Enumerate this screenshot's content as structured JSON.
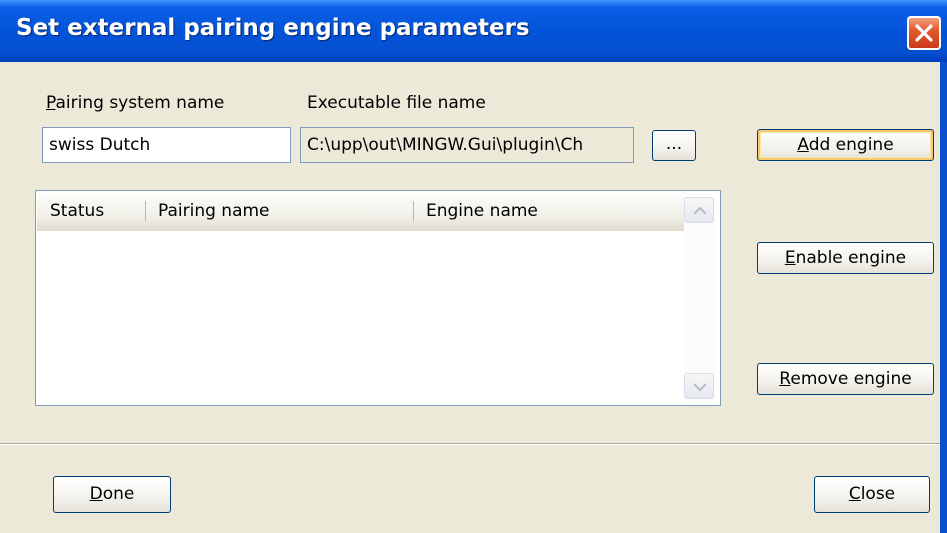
{
  "window": {
    "title": "Set external pairing engine parameters"
  },
  "form": {
    "pairing_system_label_acc": "P",
    "pairing_system_label_rest": "airing system name",
    "pairing_system_value": "swiss Dutch",
    "executable_label": "Executable file name",
    "executable_value": "C:\\upp\\out\\MINGW.Gui\\plugin\\Ch",
    "browse_label": "..."
  },
  "buttons": {
    "add_acc": "A",
    "add_rest": "dd engine",
    "enable_acc": "E",
    "enable_rest": "nable engine",
    "remove_acc": "R",
    "remove_rest": "emove engine",
    "done_acc": "D",
    "done_rest": "one",
    "close_acc": "C",
    "close_rest": "lose"
  },
  "engine_list": {
    "columns": [
      "Status",
      "Pairing name",
      "Engine name"
    ],
    "rows": []
  }
}
